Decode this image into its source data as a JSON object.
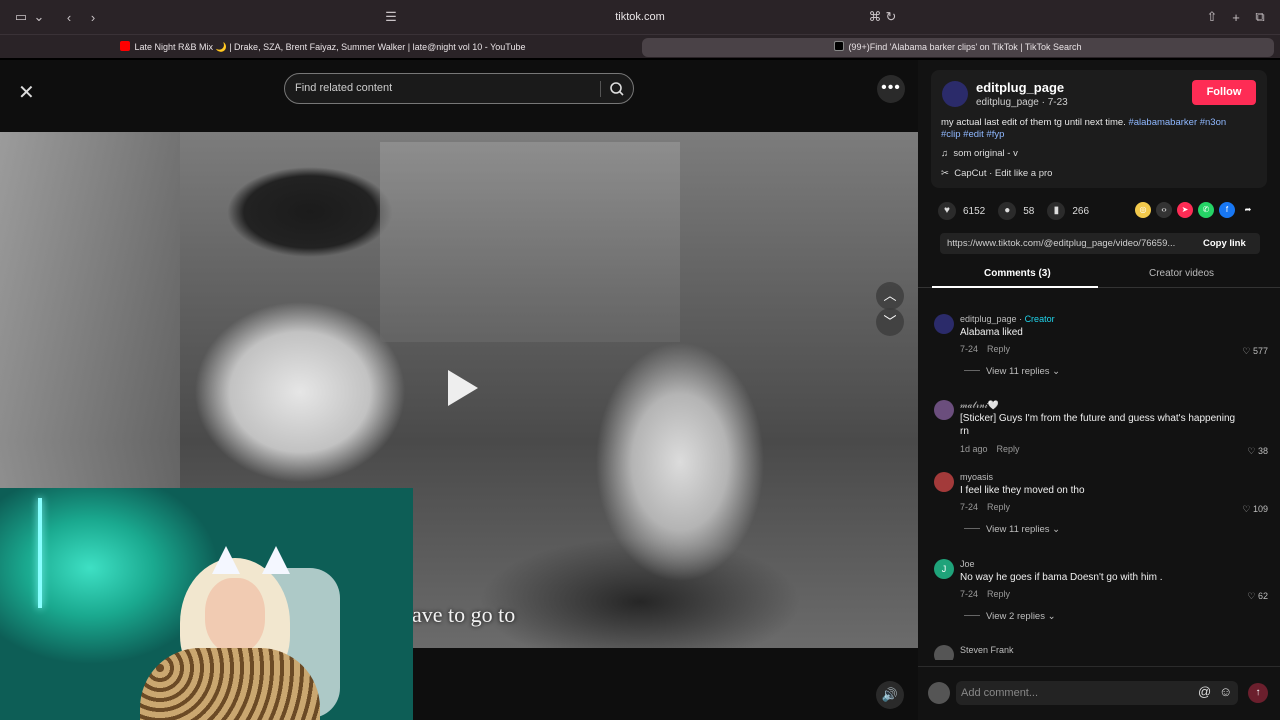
{
  "browser": {
    "url": "tiktok.com",
    "tabs": [
      {
        "label": "Late Night R&B Mix 🌙 | Drake, SZA, Brent Faiyaz, Summer Walker | late@night vol 10 - YouTube",
        "active": false,
        "favicon_color": "#ff0000"
      },
      {
        "label": "(99+)Find 'Alabama barker clips' on TikTok | TikTok Search",
        "active": true,
        "favicon_color": "#000000"
      }
    ]
  },
  "viewer": {
    "search_placeholder": "Find related content",
    "caption": "ave to go to"
  },
  "post": {
    "author": "editplug_page",
    "author_sub": "editplug_page · 7-23",
    "follow_label": "Follow",
    "desc_text": "my actual last edit of them tg until next time. ",
    "hashtags_line1": "#alabamabarker #n3on",
    "hashtags_line2": "#clip #edit #fyp",
    "music": "som original - v",
    "capcut": "CapCut · Edit like a pro",
    "likes": "6152",
    "comments": "58",
    "saves": "266",
    "link": "https://www.tiktok.com/@editplug_page/video/76659...",
    "copy_link": "Copy link",
    "tab_comments": "Comments (3)",
    "tab_creator": "Creator videos"
  },
  "comments": [
    {
      "user": "editplug_page",
      "badge": "Creator",
      "text": "Alabama liked",
      "date": "7-24",
      "reply": "Reply",
      "likes": "577",
      "replies": "View 11 replies",
      "avatar_color": "#2b2b6a"
    },
    {
      "user": "𝓂𝒶𝓁𝓇𝓃𝒾🤍",
      "badge": "",
      "text": "[Sticker] Guys I'm from the future and guess what's happening rn",
      "date": "1d ago",
      "reply": "Reply",
      "likes": "38",
      "replies": "",
      "avatar_color": "#6b4e7d"
    },
    {
      "user": "myoasis",
      "badge": "",
      "text": "I feel like they moved on tho",
      "date": "7-24",
      "reply": "Reply",
      "likes": "109",
      "replies": "View 11 replies",
      "avatar_color": "#a33a3a"
    },
    {
      "user": "Joe",
      "badge": "",
      "text": "No way he goes if bama Doesn't go with him .",
      "date": "7-24",
      "reply": "Reply",
      "likes": "62",
      "replies": "View 2 replies",
      "avatar_color": "#1fa37a"
    },
    {
      "user": "Steven Frank",
      "badge": "",
      "text": "",
      "date": "",
      "reply": "",
      "likes": "",
      "replies": "",
      "avatar_color": "#555555"
    }
  ],
  "add_comment": {
    "placeholder": "Add comment..."
  }
}
